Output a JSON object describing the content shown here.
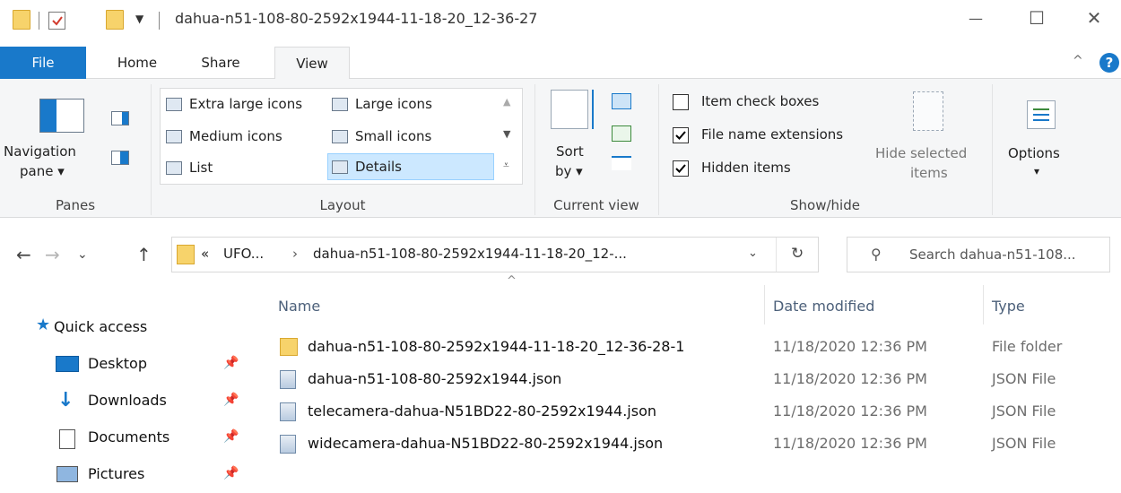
{
  "window": {
    "title": "dahua-n51-108-80-2592x1944-11-18-20_12-36-27",
    "minimize_glyph": "—",
    "maximize_glyph": "☐",
    "close_glyph": "✕"
  },
  "ribbon_tabs": [
    "File",
    "Home",
    "Share",
    "View"
  ],
  "help_glyph": "?",
  "collapse_glyph": "^",
  "ribbon": {
    "panes": {
      "navigation_pane_line1": "Navigation",
      "navigation_pane_line2": "pane ▾",
      "label": "Panes"
    },
    "layout": {
      "items": [
        "Extra large icons",
        "Large icons",
        "Medium icons",
        "Small icons",
        "List",
        "Details"
      ],
      "selected": "Details",
      "label": "Layout"
    },
    "current_view": {
      "sort_line1": "Sort",
      "sort_line2": "by ▾",
      "label": "Current view"
    },
    "show_hide": {
      "item_check_boxes": "Item check boxes",
      "item_check_boxes_checked": false,
      "file_name_extensions": "File name extensions",
      "file_name_extensions_checked": true,
      "hidden_items": "Hidden items",
      "hidden_items_checked": true,
      "hide_selected_line1": "Hide selected",
      "hide_selected_line2": "items",
      "label": "Show/hide"
    },
    "options": {
      "label": "Options",
      "arrow": "▾"
    }
  },
  "address_bar": {
    "overflow": "«",
    "crumb1": "UFO...",
    "sep": "›",
    "crumb2": "dahua-n51-108-80-2592x1944-11-18-20_12-...",
    "dropdown_glyph": "⌄",
    "refresh_glyph": "↻"
  },
  "search": {
    "placeholder": "Search dahua-n51-108..."
  },
  "nav_pane": {
    "quick_access": "Quick access",
    "items": [
      "Desktop",
      "Downloads",
      "Documents",
      "Pictures"
    ]
  },
  "columns": {
    "name": "Name",
    "date": "Date modified",
    "type": "Type",
    "sort_glyph": "^"
  },
  "files": [
    {
      "name": "dahua-n51-108-80-2592x1944-11-18-20_12-36-28-1",
      "date": "11/18/2020 12:36 PM",
      "type": "File folder",
      "kind": "folder"
    },
    {
      "name": "dahua-n51-108-80-2592x1944.json",
      "date": "11/18/2020 12:36 PM",
      "type": "JSON File",
      "kind": "json"
    },
    {
      "name": "telecamera-dahua-N51BD22-80-2592x1944.json",
      "date": "11/18/2020 12:36 PM",
      "type": "JSON File",
      "kind": "json"
    },
    {
      "name": "widecamera-dahua-N51BD22-80-2592x1944.json",
      "date": "11/18/2020 12:36 PM",
      "type": "JSON File",
      "kind": "json"
    }
  ],
  "colors": {
    "accent": "#1979ca",
    "folder": "#f7d36b",
    "selection": "#cce8ff"
  }
}
